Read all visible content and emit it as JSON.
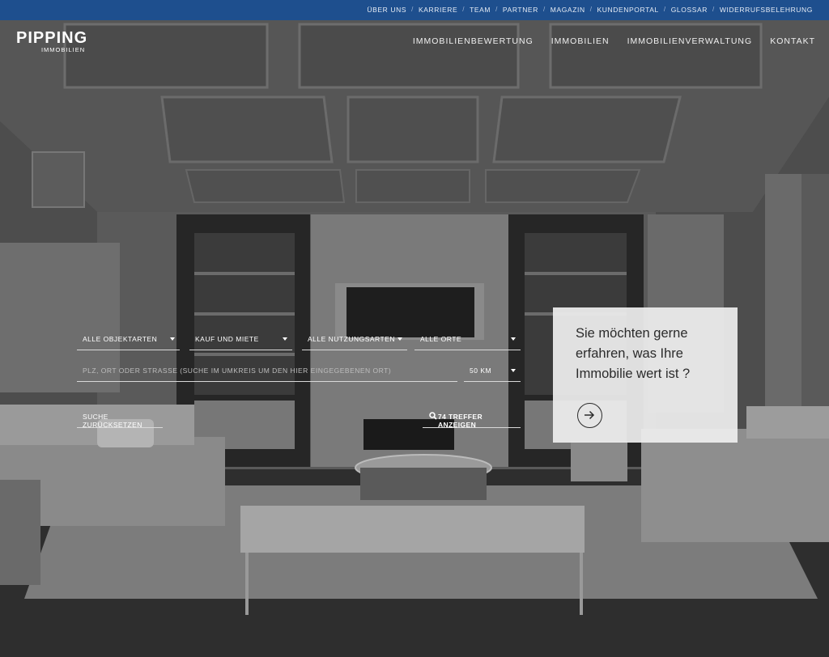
{
  "topnav": {
    "items": [
      "ÜBER UNS",
      "KARRIERE",
      "TEAM",
      "PARTNER",
      "MAGAZIN",
      "KUNDENPORTAL",
      "GLOSSAR",
      "WIDERRUFSBELEHRUNG"
    ],
    "separator": "/"
  },
  "brand": {
    "name": "PIPPING",
    "sub": "IMMOBILIEN"
  },
  "mainnav": {
    "items": [
      "IMMOBILIENBEWERTUNG",
      "IMMOBILIEN",
      "IMMOBILIENVERWALTUNG",
      "KONTAKT"
    ]
  },
  "search": {
    "type_select": "ALLE OBJEKTARTEN",
    "mode_select": "KAUF UND MIETE",
    "usage_select": "ALLE NUTZUNGSARTEN",
    "place_select": "ALLE ORTE",
    "location_placeholder": "PLZ, ORT ODER STRASSE (SUCHE IM UMKREIS UM DEN HIER EINGEGEBENEN ORT)",
    "radius_select": "50 KM",
    "reset_label": "SUCHE ZURÜCKSETZEN",
    "results_label": "74 TREFFER ANZEIGEN"
  },
  "valuation_card": {
    "question": "Sie möchten gerne erfahren, was Ihre Immobilie wert ist ?",
    "icon": "arrow-right-circle-icon"
  },
  "colors": {
    "topbar": "#1e4f8e",
    "card": "#eeeeee",
    "text_light": "#ffffff"
  }
}
